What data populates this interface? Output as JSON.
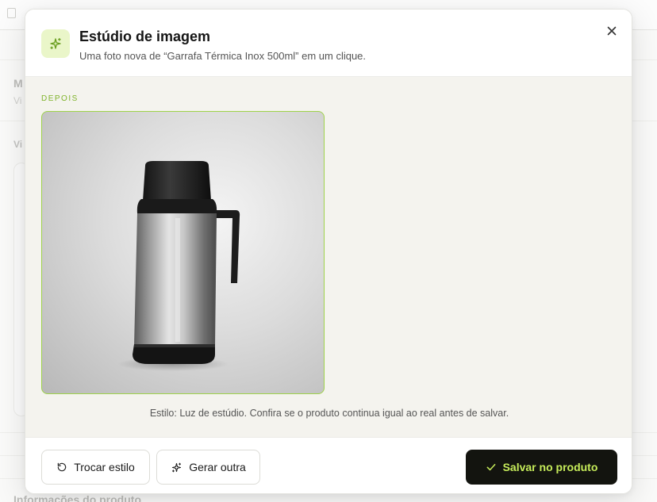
{
  "background": {
    "section_heading": "M",
    "section_sub": "Vi",
    "section_label": "Vi",
    "footer_heading": "Informações do produto"
  },
  "modal": {
    "title": "Estúdio de imagem",
    "subtitle": "Uma foto nova de “Garrafa Térmica Inox 500ml” em um clique.",
    "header_icon": "sparkle-icon",
    "close_icon": "close-icon"
  },
  "preview": {
    "section_label": "DEPOIS",
    "caption": "Estilo: Luz de estúdio. Confira se o produto continua igual ao real antes de salvar."
  },
  "actions": {
    "swap_style_label": "Trocar estilo",
    "swap_style_icon": "rotate-icon",
    "generate_label": "Gerar outra",
    "generate_icon": "sparkle-icon",
    "save_label": "Salvar no produto",
    "save_icon": "check-icon"
  },
  "colors": {
    "accent": "#9ed24a",
    "accent_light": "#eaf6c9",
    "primary_bg": "#13140f",
    "primary_text": "#c6ec5a"
  }
}
